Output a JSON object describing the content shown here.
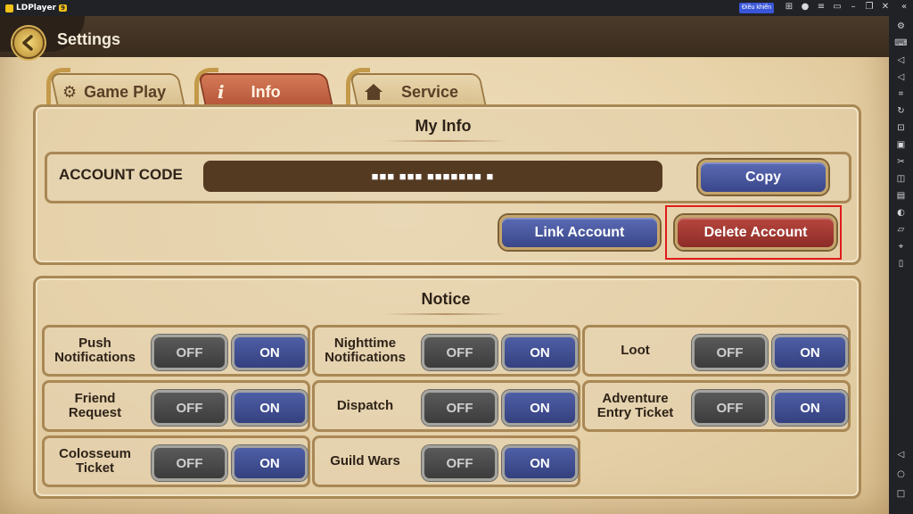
{
  "emulator": {
    "app_name": "LDPlayer",
    "version_badge": "9",
    "promo_label": "Điều khiển",
    "controls": [
      "gamepad-icon",
      "user-icon",
      "menu-icon",
      "minimize-icon",
      "restore-icon",
      "close-icon",
      "collapse-icon"
    ]
  },
  "header": {
    "title": "Settings"
  },
  "tabs": [
    {
      "label": "Game Play",
      "icon": "gear-icon",
      "active": false
    },
    {
      "label": "Info",
      "icon": "info-icon",
      "active": true
    },
    {
      "label": "Service",
      "icon": "home-icon",
      "active": false
    }
  ],
  "my_info": {
    "heading": "My Info",
    "account_code_label": "ACCOUNT CODE",
    "account_code_value": "■■■ ■■■ ■■■■■■■ ■",
    "copy_label": "Copy",
    "link_account_label": "Link Account",
    "delete_account_label": "Delete Account"
  },
  "notice": {
    "heading": "Notice",
    "off_label": "OFF",
    "on_label": "ON",
    "items": [
      {
        "label": "Push Notifications",
        "state": "on"
      },
      {
        "label": "Nighttime Notifications",
        "state": "on"
      },
      {
        "label": "Loot",
        "state": "on"
      },
      {
        "label": "Friend Request",
        "state": "on"
      },
      {
        "label": "Dispatch",
        "state": "on"
      },
      {
        "label": "Adventure Entry Ticket",
        "state": "on"
      },
      {
        "label": "Colosseum Ticket",
        "state": "on"
      },
      {
        "label": "Guild Wars",
        "state": "on"
      }
    ]
  },
  "colors": {
    "accent_blue": "#3a468a",
    "danger_red": "#8d2c27",
    "highlight_box": "#e01b1b",
    "parchment": "#e8d3aa"
  }
}
